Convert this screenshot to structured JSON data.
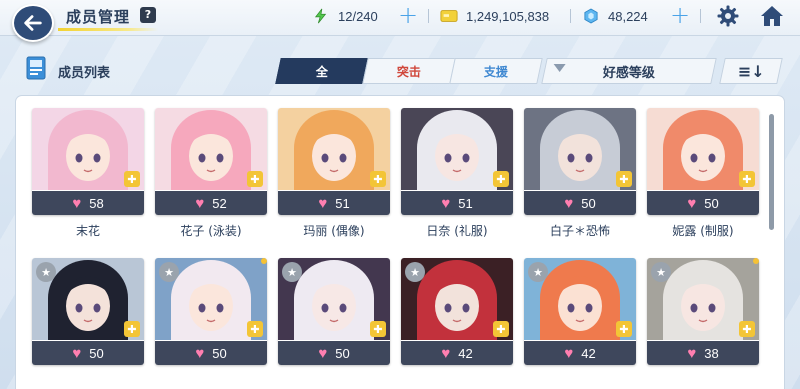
{
  "header": {
    "title": "成员管理",
    "help_label": "?",
    "ap": "12/240",
    "credits": "1,249,105,838",
    "gems": "48,224",
    "plus_label": "+"
  },
  "list": {
    "title": "成员列表",
    "tabs": [
      {
        "label": "全",
        "active": true
      },
      {
        "label": "突击",
        "active": false
      },
      {
        "label": "支援",
        "active": false
      }
    ],
    "sort_label": "好感等级",
    "sort_order_label": "≡↓"
  },
  "colors": {
    "accent": "#243a5e",
    "heart": "#ff7fb0",
    "role_badge": "#f3c536",
    "strike_tab": "#d0463a",
    "special_tab": "#3f88d1"
  },
  "students": [
    {
      "name": "末花",
      "hearts": "58",
      "bg": "#f3d6e6",
      "hair": "#f2b8cf",
      "skin": "#fbe6dc"
    },
    {
      "name": "花子 (泳装)",
      "hearts": "52",
      "bg": "#f5dbe3",
      "hair": "#f6a8bd",
      "skin": "#fbe6dc"
    },
    {
      "name": "玛丽 (偶像)",
      "hearts": "51",
      "bg": "#f4d1a0",
      "hair": "#f0a85c",
      "skin": "#fbe6dc"
    },
    {
      "name": "日奈 (礼服)",
      "hearts": "51",
      "bg": "#4a4656",
      "hair": "#e9e9ef",
      "skin": "#f7e6e2"
    },
    {
      "name": "白子＊恐怖",
      "hearts": "50",
      "bg": "#6d7383",
      "hair": "#c7ccd6",
      "skin": "#f2e2db"
    },
    {
      "name": "妮露 (制服)",
      "hearts": "50",
      "bg": "#f6dcd3",
      "hair": "#f08a6a",
      "skin": "#fbe6dc"
    },
    {
      "name": "",
      "hearts": "50",
      "bg": "#b9c6d6",
      "hair": "#1f2230",
      "skin": "#f4e2da"
    },
    {
      "name": "",
      "hearts": "50",
      "bg": "#7fa2c8",
      "hair": "#f2e9f0",
      "skin": "#fbe6dc"
    },
    {
      "name": "",
      "hearts": "50",
      "bg": "#43374f",
      "hair": "#eeeaf2",
      "skin": "#f7e8e6"
    },
    {
      "name": "",
      "hearts": "42",
      "bg": "#3b2025",
      "hair": "#c2313c",
      "skin": "#f2e2db"
    },
    {
      "name": "",
      "hearts": "42",
      "bg": "#7fb3d8",
      "hair": "#ef7a4d",
      "skin": "#fbe1d3"
    },
    {
      "name": "",
      "hearts": "38",
      "bg": "#a5a39c",
      "hair": "#e5e3e0",
      "skin": "#f7e6e2"
    }
  ]
}
